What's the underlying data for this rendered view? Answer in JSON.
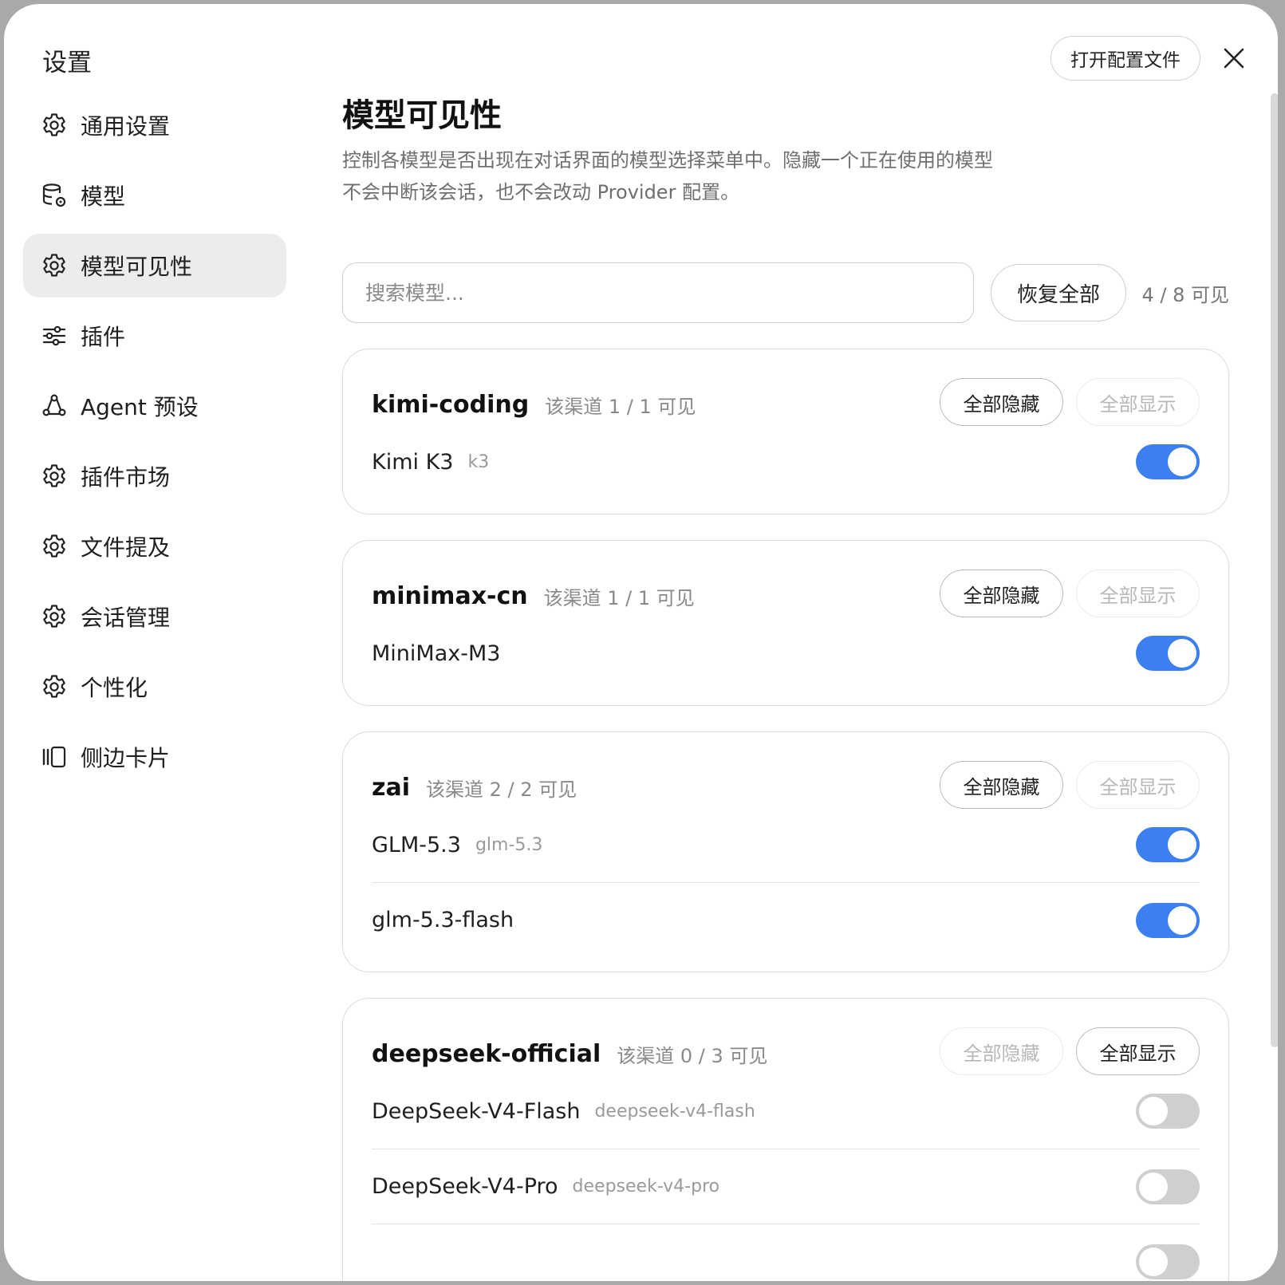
{
  "window": {
    "title": "设置",
    "open_config_label": "打开配置文件"
  },
  "sidebar": {
    "items": [
      {
        "label": "通用设置",
        "icon": "gear-icon"
      },
      {
        "label": "模型",
        "icon": "database-gear-icon"
      },
      {
        "label": "模型可见性",
        "icon": "gear-icon",
        "active": true
      },
      {
        "label": "插件",
        "icon": "sliders-icon"
      },
      {
        "label": "Agent 预设",
        "icon": "agent-nodes-icon"
      },
      {
        "label": "插件市场",
        "icon": "gear-icon"
      },
      {
        "label": "文件提及",
        "icon": "gear-icon"
      },
      {
        "label": "会话管理",
        "icon": "gear-icon"
      },
      {
        "label": "个性化",
        "icon": "gear-icon"
      },
      {
        "label": "侧边卡片",
        "icon": "side-cards-icon"
      }
    ]
  },
  "main": {
    "title": "模型可见性",
    "desc_line1": "控制各模型是否出现在对话界面的模型选择菜单中。隐藏一个正在使用的模型",
    "desc_line2": "不会中断该会话，也不会改动 Provider 配置。",
    "search_placeholder": "搜索模型...",
    "restore_label": "恢复全部",
    "visible_count": "4 / 8 可见",
    "hide_all_label": "全部隐藏",
    "show_all_label": "全部显示",
    "groups": [
      {
        "name": "kimi-coding",
        "count": "该渠道 1 / 1 可见",
        "hide_enabled": true,
        "show_enabled": false,
        "models": [
          {
            "name": "Kimi K3",
            "id": "k3",
            "on": true
          }
        ]
      },
      {
        "name": "minimax-cn",
        "count": "该渠道 1 / 1 可见",
        "hide_enabled": true,
        "show_enabled": false,
        "models": [
          {
            "name": "MiniMax-M3",
            "id": "",
            "on": true
          }
        ]
      },
      {
        "name": "zai",
        "count": "该渠道 2 / 2 可见",
        "hide_enabled": true,
        "show_enabled": false,
        "models": [
          {
            "name": "GLM-5.3",
            "id": "glm-5.3",
            "on": true
          },
          {
            "name": "glm-5.3-flash",
            "id": "",
            "on": true
          }
        ]
      },
      {
        "name": "deepseek-official",
        "count": "该渠道 0 / 3 可见",
        "hide_enabled": false,
        "show_enabled": true,
        "models": [
          {
            "name": "DeepSeek-V4-Flash",
            "id": "deepseek-v4-flash",
            "on": false
          },
          {
            "name": "DeepSeek-V4-Pro",
            "id": "deepseek-v4-pro",
            "on": false
          },
          {
            "name": "",
            "id": "",
            "on": false
          }
        ]
      }
    ]
  },
  "colors": {
    "accent": "#3b7ff0",
    "toggle_off": "#cfcfcf",
    "active_nav_bg": "#ececef"
  }
}
